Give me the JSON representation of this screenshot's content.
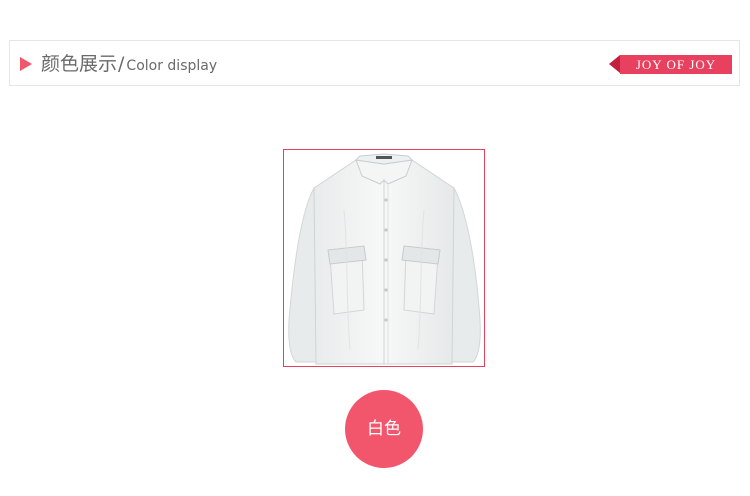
{
  "header": {
    "title_cn": "颜色展示",
    "separator": "/",
    "title_en": "Color display",
    "brand": "JOY OF JOY"
  },
  "product": {
    "image_icon": "white-shirt-photo"
  },
  "color_option": {
    "label": "白色"
  },
  "colors": {
    "accent": "#f2566c",
    "brand_badge": "#e8405f",
    "brand_tab": "#c31f3e",
    "text": "#6a6a6a",
    "border": "#e6e6e6"
  }
}
